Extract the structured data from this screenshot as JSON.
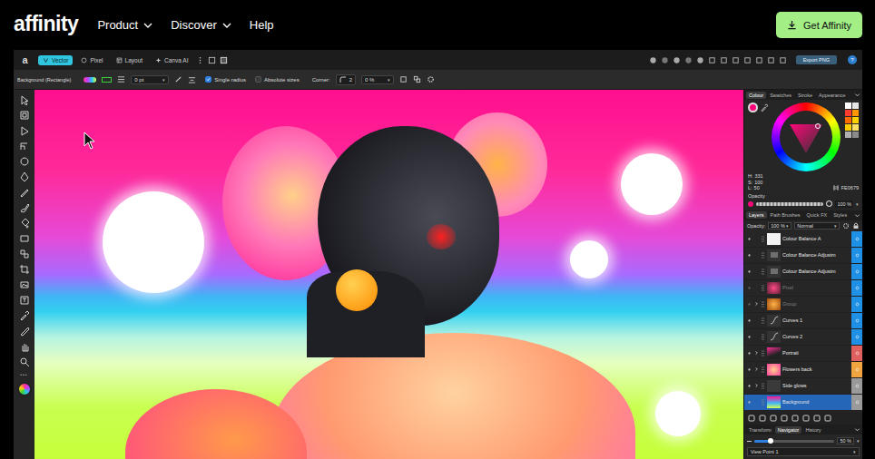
{
  "nav": {
    "logo": "affinity",
    "items": [
      {
        "label": "Product",
        "dropdown": true
      },
      {
        "label": "Discover",
        "dropdown": true
      },
      {
        "label": "Help",
        "dropdown": false
      }
    ],
    "cta": "Get Affinity"
  },
  "app": {
    "logo": "a",
    "personas": [
      {
        "label": "Vector",
        "selected": true
      },
      {
        "label": "Pixel",
        "selected": false
      },
      {
        "label": "Layout",
        "selected": false
      },
      {
        "label": "Canva AI",
        "selected": false
      }
    ],
    "export": "Export PNG",
    "help": "?"
  },
  "context": {
    "object": "Background (Rectangle)",
    "stroke_width": "0 pt",
    "options": [
      {
        "label": "Single radius",
        "checked": true
      },
      {
        "label": "Absolute sizes",
        "checked": false
      }
    ],
    "corner_label": "Corner:",
    "corner_count": "2",
    "corner_value": "0 %"
  },
  "colour": {
    "tabs": [
      {
        "label": "Colour",
        "selected": true
      },
      {
        "label": "Swatches",
        "selected": false
      },
      {
        "label": "Stroke",
        "selected": false
      },
      {
        "label": "Appearance",
        "selected": false
      }
    ],
    "hsl": [
      {
        "label": "H:",
        "value": "331"
      },
      {
        "label": "S:",
        "value": "100"
      },
      {
        "label": "L:",
        "value": "50"
      }
    ],
    "hex": "FE0679",
    "opacity_label": "Opacity",
    "opacity": {
      "level": 1,
      "reading": "100 %"
    },
    "swatches": [
      {
        "color": "#ffffff"
      },
      {
        "color": "#e6e6e6"
      },
      {
        "color": "#ff3b30"
      },
      {
        "color": "#ff9500"
      },
      {
        "color": "#ff6a00"
      },
      {
        "color": "#ffd000"
      },
      {
        "color": "#ffcc00"
      },
      {
        "color": "#ffe066"
      },
      {
        "color": "#b0b0b0"
      },
      {
        "color": "#8a8a8a"
      }
    ]
  },
  "layers": {
    "tabs": [
      {
        "label": "Layers",
        "selected": true
      },
      {
        "label": "Path Brushes",
        "selected": false
      },
      {
        "label": "Quick FX",
        "selected": false
      },
      {
        "label": "Styles",
        "selected": false
      }
    ],
    "opacity_label": "Opacity:",
    "opacity": "100 %",
    "blend": "Normal",
    "items": [
      {
        "name": "Colour Balance A",
        "kind": "mask",
        "visible": true,
        "expandable": false,
        "selected": false,
        "color": "#1e90e6"
      },
      {
        "name": "Colour Balance Adjustm",
        "kind": "adjustment",
        "visible": true,
        "expandable": false,
        "selected": false,
        "color": "#1e90e6"
      },
      {
        "name": "Colour Balance Adjustm",
        "kind": "adjustment",
        "visible": true,
        "expandable": false,
        "selected": false,
        "color": "#1e90e6"
      },
      {
        "name": "Pixel",
        "kind": "pixel",
        "visible": false,
        "expandable": false,
        "selected": false,
        "color": "#1e90e6"
      },
      {
        "name": "Group",
        "kind": "group",
        "visible": false,
        "expandable": true,
        "selected": false,
        "color": "#1e90e6"
      },
      {
        "name": "Curves 1",
        "kind": "curves",
        "visible": true,
        "expandable": false,
        "selected": false,
        "color": "#1e90e6"
      },
      {
        "name": "Curves 2",
        "kind": "curves",
        "visible": true,
        "expandable": false,
        "selected": false,
        "color": "#1e90e6"
      },
      {
        "name": "Portrait",
        "kind": "portrait",
        "visible": true,
        "expandable": true,
        "selected": false,
        "color": "#e06060"
      },
      {
        "name": "Flowers back",
        "kind": "flowers",
        "visible": true,
        "expandable": true,
        "selected": false,
        "color": "#f0a540"
      },
      {
        "name": "Side glows",
        "kind": "blank",
        "visible": true,
        "expandable": true,
        "selected": false,
        "color": "#9a9a9a"
      },
      {
        "name": "Background",
        "kind": "gradient",
        "visible": true,
        "expandable": false,
        "selected": true,
        "color": "#9a9a9a"
      }
    ]
  },
  "bottom": {
    "tabs": [
      {
        "label": "Transform",
        "selected": false
      },
      {
        "label": "Navigator",
        "selected": true
      },
      {
        "label": "History",
        "selected": false
      }
    ],
    "zoom": {
      "level": 0.2,
      "reading": "50 %"
    },
    "view": "View Point 1"
  }
}
